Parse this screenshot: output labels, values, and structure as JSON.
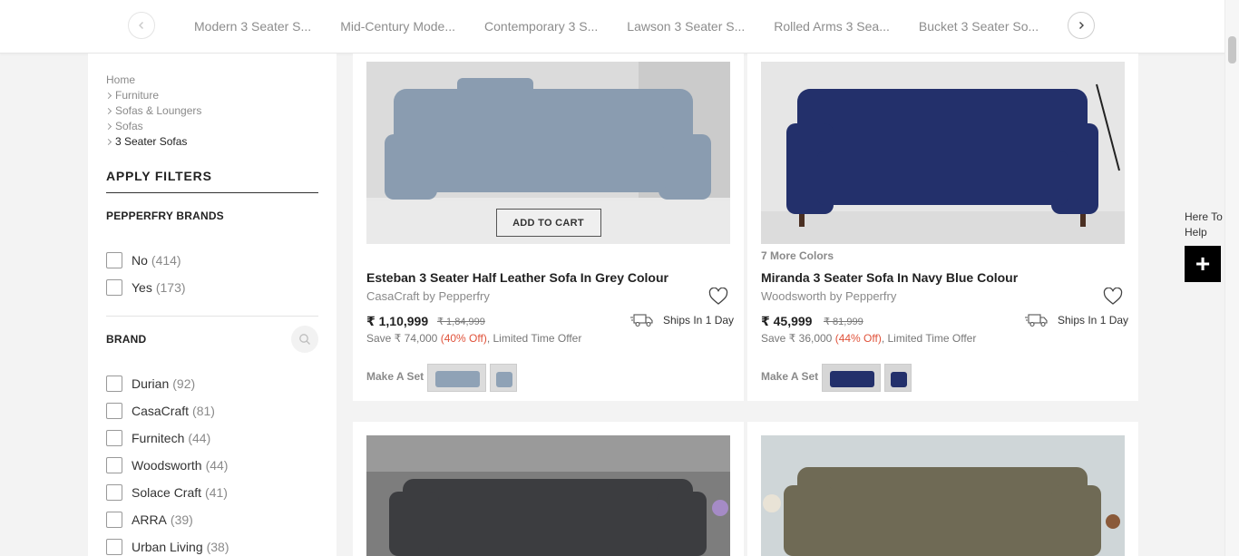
{
  "top_nav": {
    "prev_icon": "chevron-left-icon",
    "next_icon": "chevron-right-icon",
    "tabs": [
      "Modern 3 Seater S...",
      "Mid-Century Mode...",
      "Contemporary 3 S...",
      "Lawson 3 Seater S...",
      "Rolled Arms 3 Sea...",
      "Bucket 3 Seater So..."
    ]
  },
  "breadcrumb": [
    "Home",
    "Furniture",
    "Sofas & Loungers",
    "Sofas",
    "3 Seater Sofas"
  ],
  "filters": {
    "heading": "APPLY FILTERS",
    "pepperfry_brands": {
      "title": "PEPPERFRY BRANDS",
      "options": [
        {
          "label": "No",
          "count": "(414)"
        },
        {
          "label": "Yes",
          "count": "(173)"
        }
      ]
    },
    "brand": {
      "title": "BRAND",
      "search_icon": "search-icon",
      "options": [
        {
          "label": "Durian",
          "count": "(92)"
        },
        {
          "label": "CasaCraft",
          "count": "(81)"
        },
        {
          "label": "Furnitech",
          "count": "(44)"
        },
        {
          "label": "Woodsworth",
          "count": "(44)"
        },
        {
          "label": "Solace Craft",
          "count": "(41)"
        },
        {
          "label": "ARRA",
          "count": "(39)"
        },
        {
          "label": "Urban Living",
          "count": "(38)"
        }
      ]
    }
  },
  "products": [
    {
      "name": "Esteban 3 Seater Half Leather Sofa In Grey Colour",
      "brand": "CasaCraft by Pepperfry",
      "price": "₹ 1,10,999",
      "mrp": "₹ 1,84,999",
      "save_prefix": "Save ₹ 74,000 ",
      "save_off": "(40% Off)",
      "save_suffix": ", Limited Time Offer",
      "shipping": "Ships In 1 Day",
      "add_to_cart": "ADD TO CART",
      "make_a_set": "Make A Set",
      "sofa_color": "#8fa2b6"
    },
    {
      "more_colors": "7 More Colors",
      "name": "Miranda 3 Seater Sofa In Navy Blue Colour",
      "brand": "Woodsworth by Pepperfry",
      "price": "₹ 45,999",
      "mrp": "₹ 81,999",
      "save_prefix": "Save ₹ 36,000 ",
      "save_off": "(44% Off)",
      "save_suffix": ", Limited Time Offer",
      "shipping": "Ships In 1 Day",
      "make_a_set": "Make A Set",
      "sofa_color": "#23306b"
    },
    {
      "sofa_color": "#3c3d40"
    },
    {
      "sofa_color": "#6f6a55"
    }
  ],
  "help": {
    "label": "Here To Help",
    "icon": "plus-icon",
    "symbol": "+"
  },
  "colors": {
    "accent_off": "#e0523a"
  }
}
